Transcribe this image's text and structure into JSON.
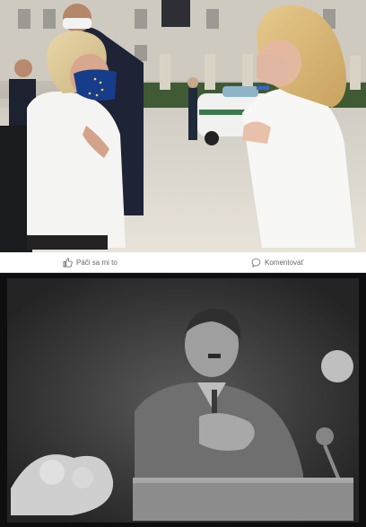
{
  "post": {
    "actions": {
      "like_label": "Páči sa mi to",
      "comment_label": "Komentovať"
    }
  },
  "icons": {
    "like": "thumbs-up-icon",
    "comment": "speech-bubble-icon"
  },
  "colors": {
    "action_text": "#65676b",
    "divider": "#dadde1",
    "archive_frame": "#0e0e0e"
  }
}
